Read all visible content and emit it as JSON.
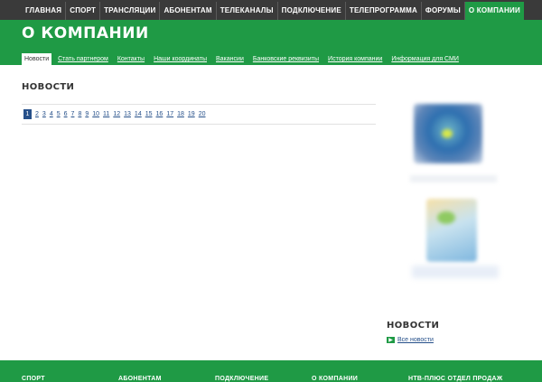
{
  "topnav": {
    "items": [
      "ГЛАВНАЯ",
      "СПОРТ",
      "ТРАНСЛЯЦИИ",
      "АБОНЕНТАМ",
      "ТЕЛЕКАНАЛЫ",
      "ПОДКЛЮЧЕНИЕ",
      "ТЕЛЕПРОГРАММА",
      "ФОРУМЫ",
      "О КОМПАНИИ"
    ],
    "active": "О КОМПАНИИ"
  },
  "header": {
    "title": "О КОМПАНИИ",
    "subnav": [
      "Новости",
      "Стать партнером",
      "Контакты",
      "Наши координаты",
      "Вакансии",
      "Банковские реквизиты",
      "История компании",
      "Информация для СМИ"
    ]
  },
  "main": {
    "news_title": "НОВОСТИ",
    "pages": [
      "1",
      "2",
      "3",
      "4",
      "5",
      "6",
      "7",
      "8",
      "9",
      "10",
      "11",
      "12",
      "13",
      "14",
      "15",
      "16",
      "17",
      "18",
      "19",
      "20"
    ],
    "current_page": "1"
  },
  "sidebar": {
    "news_title": "НОВОСТИ",
    "all_news": "Все новости"
  },
  "footer": {
    "columns": [
      "СПОРТ",
      "АБОНЕНТАМ",
      "ПОДКЛЮЧЕНИЕ",
      "О КОМПАНИИ",
      "НТВ-ПЛЮС ОТДЕЛ ПРОДАЖ"
    ]
  },
  "colors": {
    "brand_green": "#1f9a45",
    "topbar": "#3a3a3a",
    "link_blue": "#26508a"
  }
}
